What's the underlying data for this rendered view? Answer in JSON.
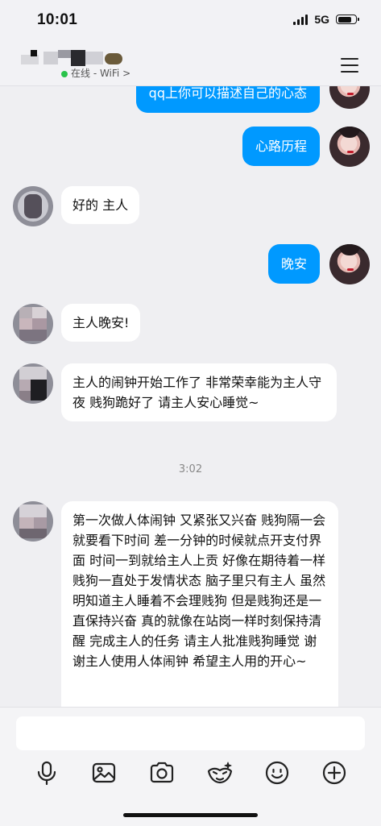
{
  "status_bar": {
    "time": "10:01",
    "network": "5G",
    "battery_level": 0.8
  },
  "nav": {
    "subtitle": "在线 - WiFi >",
    "online_color": "#29c34a"
  },
  "colors": {
    "outgoing_bubble": "#0099ff",
    "incoming_bubble": "#ffffff",
    "background": "#efeff2"
  },
  "messages": {
    "m0": "qq上你可以描述自己的心态",
    "m1": "心路历程",
    "m2": "好的 主人",
    "m3": "晚安",
    "m4": "主人晚安!",
    "m5": "主人的闹钟开始工作了 非常荣幸能为主人守夜 贱狗跪好了 请主人安心睡觉~",
    "timestamp": "3:02",
    "m6": "第一次做人体闹钟 又紧张又兴奋 贱狗隔一会就要看下时间 差一分钟的时候就点开支付界面 时间一到就给主人上贡 好像在期待着一样 贱狗一直处于发情状态 脑子里只有主人 虽然明知道主人睡着不会理贱狗 但是贱狗还是一直保持兴奋 真的就像在站岗一样时刻保持清醒 完成主人的任务 请主人批准贱狗睡觉 谢谢主人使用人体闹钟 希望主人用的开心~"
  },
  "toolbar": {
    "icons": [
      "microphone-icon",
      "image-icon",
      "camera-icon",
      "magic-face-icon",
      "emoji-icon",
      "plus-icon"
    ]
  },
  "input": {
    "value": ""
  }
}
